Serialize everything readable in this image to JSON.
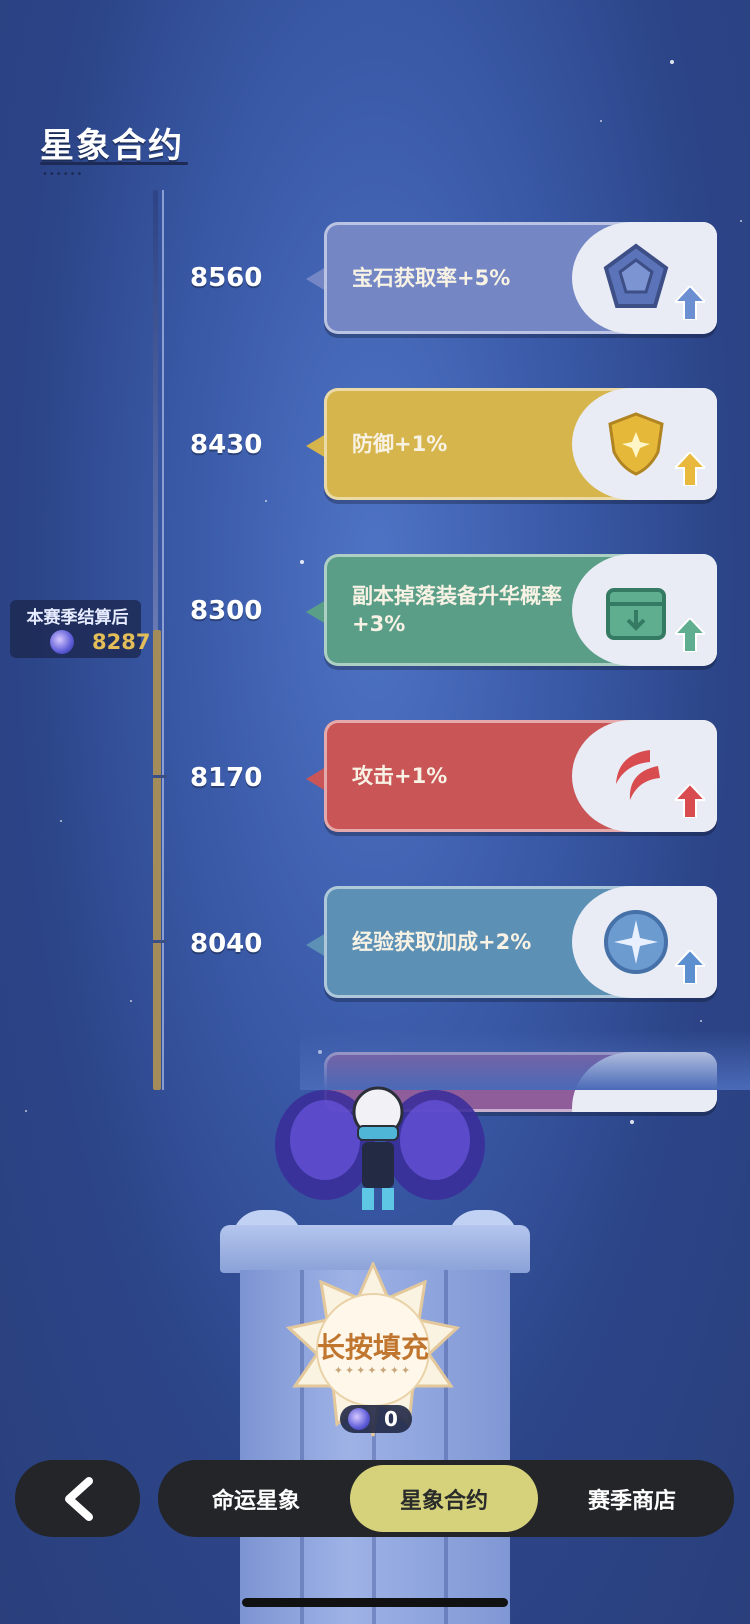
{
  "header": {
    "title": "星象合约"
  },
  "season": {
    "label": "本赛季结算后",
    "value": "8287"
  },
  "rewards": [
    {
      "threshold": "8560",
      "text": "宝石获取率+5%",
      "icon": "gem-icon",
      "color": "#7487c4"
    },
    {
      "threshold": "8430",
      "text": "防御+1%",
      "icon": "shield-icon",
      "color": "#d7b54d"
    },
    {
      "threshold": "8300",
      "text": "副本掉落装备升华概率+3%",
      "icon": "box-icon",
      "color": "#5b9e88"
    },
    {
      "threshold": "8170",
      "text": "攻击+1%",
      "icon": "attack-swirl-icon",
      "color": "#c95557"
    },
    {
      "threshold": "8040",
      "text": "经验获取加成+2%",
      "icon": "star-compass-icon",
      "color": "#5d90b5"
    }
  ],
  "fill_button": {
    "label": "长按填充",
    "count": "0"
  },
  "nav": {
    "back_icon": "chevron-left-icon",
    "tabs": [
      {
        "label": "命运星象",
        "active": false
      },
      {
        "label": "星象合约",
        "active": true
      },
      {
        "label": "赛季商店",
        "active": false
      }
    ]
  }
}
